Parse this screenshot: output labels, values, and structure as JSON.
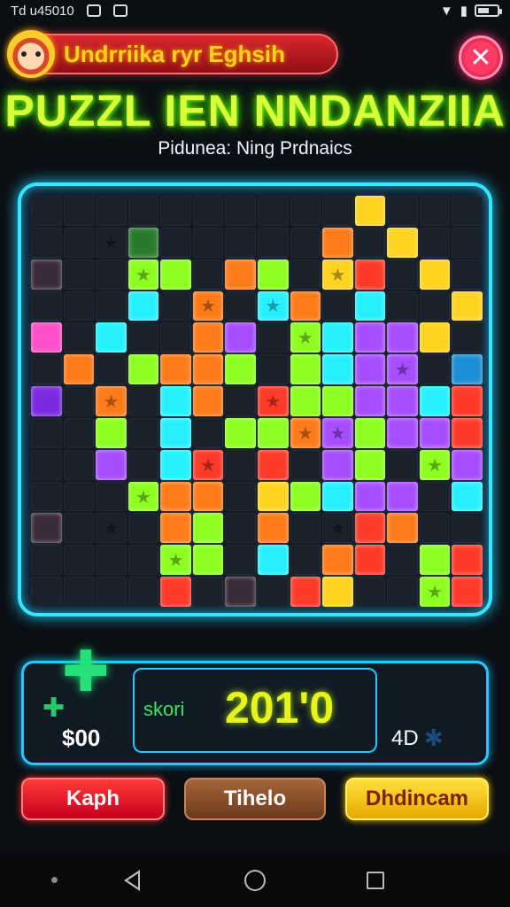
{
  "status_bar": {
    "time": "Td u45010",
    "icons": [
      "notification-icon",
      "image-icon",
      "wifi-icon",
      "signal-icon",
      "battery-icon"
    ],
    "battery_level": 0.6
  },
  "header": {
    "pill_label": "Undrriika ryr Eghsih",
    "close_symbol": "✕",
    "title": "PUZZL IEN NNDANZIIA",
    "subtitle": "Pidunea: Ning Prdnaics"
  },
  "board": {
    "rows": 13,
    "cols": 14,
    "palette": {
      "G": "#8cff20",
      "L": "#5ce638",
      "O": "#ff7a18",
      "R": "#ff3a28",
      "Y": "#ffd320",
      "C": "#26f0ff",
      "P": "#a64dff",
      "V": "#7a2be0",
      "M": "#ff4fc8",
      "B": "#1a8fd6",
      "D": "#2a7a2e",
      "K": "#3a2a3a"
    },
    "cells": [
      "..........Y...",
      "...D.....O.Y..",
      "K..GG.OG.YR.Y.OO",
      "...C.O.CO.C..Y.",
      "M.C..OP.GCPPY.",
      ".O.GOOG.GCPP.B",
      "V.O.CO.RGGPPCRR",
      "..G.C.GGOPGPPR.",
      "..P.CR.R.PG.GP.",
      "...GOO.YGCPP.C.",
      "K...OG.O..RO...",
      "....GG.C.OR.GR.",
      "....R.K.RY..GR."
    ],
    "stars": [
      [
        1,
        2
      ],
      [
        2,
        3
      ],
      [
        2,
        9
      ],
      [
        3,
        5
      ],
      [
        3,
        7
      ],
      [
        4,
        8
      ],
      [
        5,
        11
      ],
      [
        6,
        2
      ],
      [
        6,
        7
      ],
      [
        7,
        8
      ],
      [
        7,
        9
      ],
      [
        8,
        5
      ],
      [
        8,
        12
      ],
      [
        9,
        3
      ],
      [
        10,
        2
      ],
      [
        10,
        9
      ],
      [
        11,
        4
      ],
      [
        12,
        12
      ]
    ]
  },
  "score_panel": {
    "coins": "$00",
    "score_label": "skori",
    "score_value": "201'0",
    "extra_label": "4D",
    "extra_symbol": "✱",
    "piece_symbol": "✚"
  },
  "buttons": {
    "red": "Kaph",
    "brown": "Tihelo",
    "yellow": "Dhdincam"
  }
}
